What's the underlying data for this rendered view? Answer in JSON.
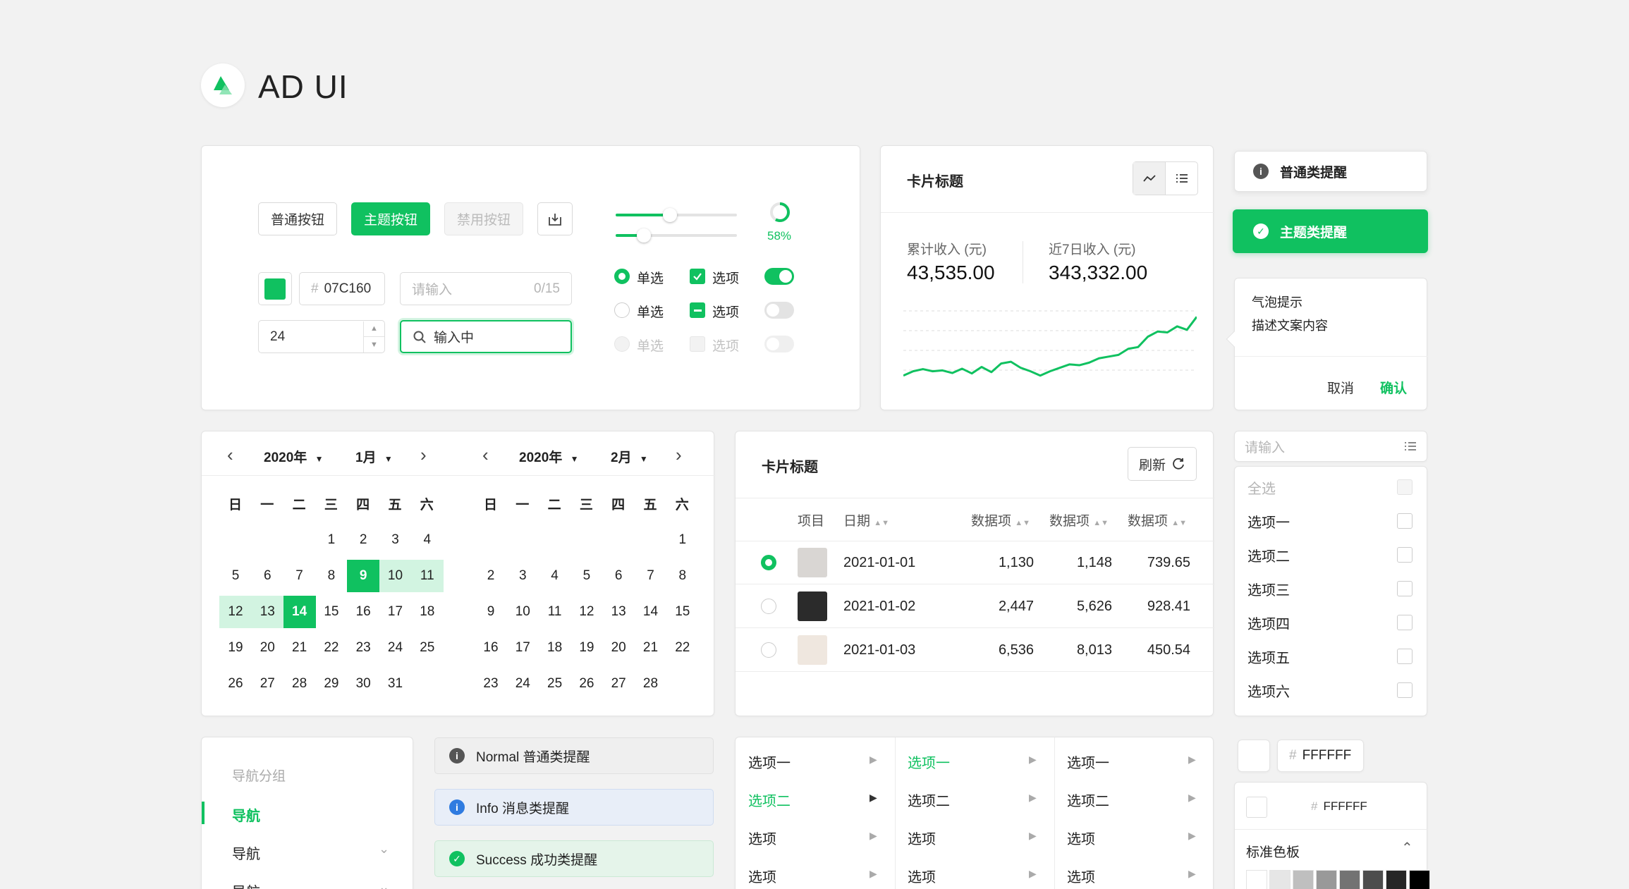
{
  "app": {
    "title": "AD UI"
  },
  "controls": {
    "btn_normal": "普通按钮",
    "btn_primary": "主题按钮",
    "btn_disabled": "禁用按钮",
    "progress_text": "58%",
    "progress_value": 0.58,
    "slider1_value": 0.45,
    "slider2_value": 0.23,
    "color_swatch": "#10C160",
    "color_hex": "07C160",
    "hash": "#",
    "input_placeholder": "请输入",
    "input_count": "0/15",
    "number_value": "24",
    "search_value": "输入中",
    "radio_label": "单选",
    "check_label": "选项"
  },
  "stats": {
    "title": "卡片标题",
    "label1": "累计收入 (元)",
    "value1": "43,535.00",
    "label2": "近7日收入 (元)",
    "value2": "343,332.00",
    "line_values": [
      2,
      3,
      3.5,
      3,
      3.2,
      2.6,
      3.6,
      2.5,
      4,
      2.8,
      4.8,
      5.2,
      3.8,
      3,
      2,
      3,
      3.8,
      4.6,
      4.4,
      5,
      6,
      6.4,
      6.8,
      8.2,
      8.6,
      11,
      12.2,
      12,
      13.4,
      12.6,
      15.6
    ]
  },
  "notices": {
    "normal": "普通类提醒",
    "primary": "主题类提醒",
    "pop_title": "气泡提示",
    "pop_desc": "描述文案内容",
    "cancel": "取消",
    "confirm": "确认"
  },
  "calendar": {
    "left": {
      "year": "2020年",
      "month": "1月"
    },
    "right": {
      "year": "2020年",
      "month": "2月"
    },
    "weekdays": [
      "日",
      "一",
      "二",
      "三",
      "四",
      "五",
      "六"
    ],
    "left_days": [
      "",
      "",
      "",
      "1",
      "2",
      "3",
      "4",
      "5",
      "6",
      "7",
      "8",
      "9",
      "10",
      "11",
      "12",
      "13",
      "14",
      "15",
      "16",
      "17",
      "18",
      "19",
      "20",
      "21",
      "22",
      "23",
      "24",
      "25",
      "26",
      "27",
      "28",
      "29",
      "30",
      "31"
    ],
    "right_days": [
      "",
      "",
      "",
      "",
      "",
      "",
      "1",
      "2",
      "3",
      "4",
      "5",
      "6",
      "7",
      "8",
      "9",
      "10",
      "11",
      "12",
      "13",
      "14",
      "15",
      "16",
      "17",
      "18",
      "19",
      "20",
      "21",
      "22",
      "23",
      "24",
      "25",
      "26",
      "27",
      "28"
    ],
    "range_start": 9,
    "range_end": 14
  },
  "table": {
    "title": "卡片标题",
    "refresh": "刷新",
    "headers": [
      "项目",
      "日期",
      "数据项",
      "数据项",
      "数据项"
    ],
    "rows": [
      {
        "date": "2021-01-01",
        "a": "1,130",
        "b": "1,148",
        "c": "739.65",
        "selected": true
      },
      {
        "date": "2021-01-02",
        "a": "2,447",
        "b": "5,626",
        "c": "928.41",
        "selected": false
      },
      {
        "date": "2021-01-03",
        "a": "6,536",
        "b": "8,013",
        "c": "450.54",
        "selected": false
      }
    ]
  },
  "multiselect": {
    "placeholder": "请输入",
    "options": [
      "全选",
      "选项一",
      "选项二",
      "选项三",
      "选项四",
      "选项五",
      "选项六"
    ]
  },
  "nav": {
    "group": "导航分组",
    "items": [
      "导航",
      "导航",
      "导航"
    ]
  },
  "alerts": {
    "normal": "Normal 普通类提醒",
    "info": "Info 消息类提醒",
    "success": "Success 成功类提醒"
  },
  "cascader": {
    "col1": [
      "选项一",
      "选项二",
      "选项",
      "选项"
    ],
    "col2": [
      "选项一",
      "选项二",
      "选项",
      "选项"
    ],
    "col3": [
      "选项一",
      "选项二",
      "选项",
      "选项"
    ]
  },
  "colorpicker": {
    "hex": "FFFFFF",
    "hash": "#",
    "panel_title": "标准色板",
    "swatches": [
      "#ffffff",
      "#e6e6e6",
      "#bfbfbf",
      "#999999",
      "#737373",
      "#4d4d4d",
      "#262626",
      "#000000"
    ]
  },
  "colors": {
    "primary": "#10C160",
    "info": "#2f7be0"
  }
}
